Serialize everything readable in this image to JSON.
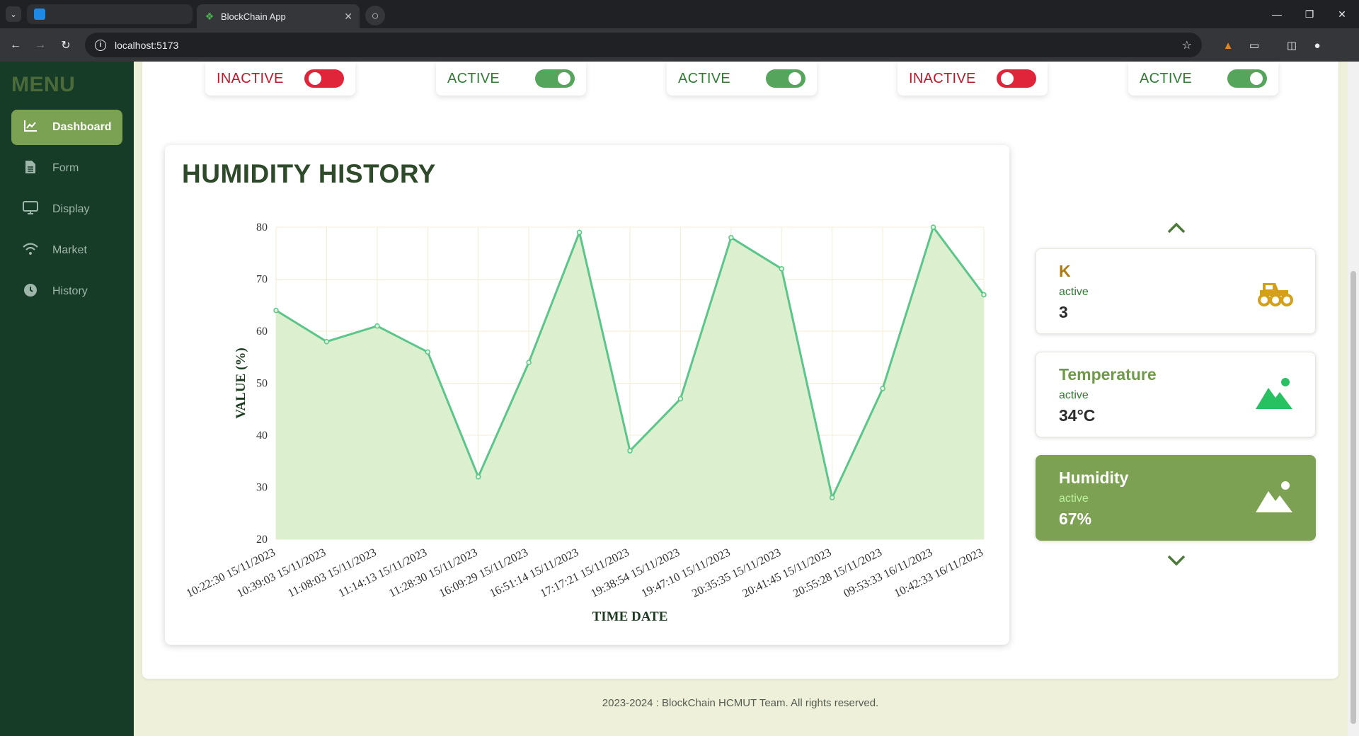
{
  "browser": {
    "tabs": [
      {
        "title": ""
      },
      {
        "title": "BlockChain App"
      }
    ],
    "url": "localhost:5173"
  },
  "sidebar": {
    "title": "MENU",
    "items": [
      {
        "label": "Dashboard",
        "icon": "chart-line-icon",
        "active": true
      },
      {
        "label": "Form",
        "icon": "document-icon",
        "active": false
      },
      {
        "label": "Display",
        "icon": "monitor-icon",
        "active": false
      },
      {
        "label": "Market",
        "icon": "wifi-icon",
        "active": false
      },
      {
        "label": "History",
        "icon": "clock-icon",
        "active": false
      }
    ]
  },
  "status_cards": [
    {
      "label": "INACTIVE",
      "on": false
    },
    {
      "label": "ACTIVE",
      "on": true
    },
    {
      "label": "ACTIVE",
      "on": true
    },
    {
      "label": "INACTIVE",
      "on": false
    },
    {
      "label": "ACTIVE",
      "on": true
    }
  ],
  "chart_title": "HUMIDITY HISTORY",
  "chart_data": {
    "type": "area",
    "xlabel": "TIME DATE",
    "ylabel": "VALUE (%)",
    "ylim": [
      20,
      80
    ],
    "yticks": [
      20,
      30,
      40,
      50,
      60,
      70,
      80
    ],
    "grid": true,
    "categories": [
      "10:22:30 15/11/2023",
      "10:39:03 15/11/2023",
      "11:08:03 15/11/2023",
      "11:14:13 15/11/2023",
      "11:28:30 15/11/2023",
      "16:09:29 15/11/2023",
      "16:51:14 15/11/2023",
      "17:17:21 15/11/2023",
      "19:38:54 15/11/2023",
      "19:47:10 15/11/2023",
      "20:35:35 15/11/2023",
      "20:41:45 15/11/2023",
      "20:55:28 15/11/2023",
      "09:53:33 16/11/2023",
      "10:42:33 16/11/2023"
    ],
    "values": [
      64,
      58,
      61,
      56,
      32,
      54,
      79,
      37,
      47,
      78,
      72,
      28,
      49,
      80,
      67
    ],
    "line_color": "#5cc58a",
    "fill_color": "#dcefcf"
  },
  "sensors": [
    {
      "name": "K",
      "state": "active",
      "value": "3",
      "icon": "tractor-icon",
      "name_color": "#b07a0c",
      "state_color": "#2e7d32",
      "icon_color": "#d4a017",
      "selected": false
    },
    {
      "name": "Temperature",
      "state": "active",
      "value": "34°C",
      "icon": "mountain-icon",
      "name_color": "#6e9a49",
      "state_color": "#2e7d32",
      "icon_color": "#27c162",
      "selected": false
    },
    {
      "name": "Humidity",
      "state": "active",
      "value": "67%",
      "icon": "mountain-icon",
      "name_color": "#ffffff",
      "state_color": "#b8f29a",
      "icon_color": "#ffffff",
      "selected": true
    }
  ],
  "footer": "2023-2024 : BlockChain HCMUT Team. All rights reserved."
}
